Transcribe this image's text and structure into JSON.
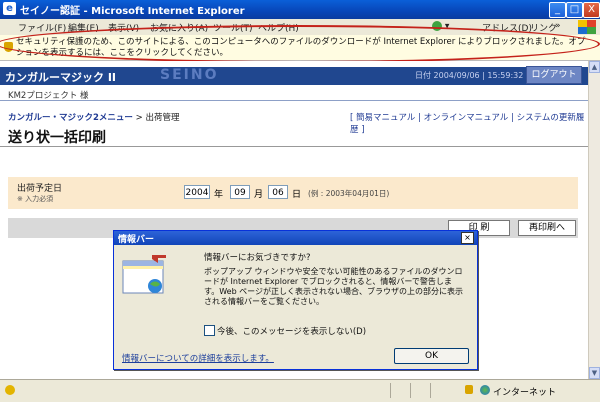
{
  "window": {
    "title": "セイノー認証 - Microsoft Internet Explorer",
    "buttons": [
      "_",
      "□",
      "X"
    ]
  },
  "menu": {
    "items": [
      "ファイル(F)",
      "編集(E)",
      "表示(V)",
      "お気に入り(A)",
      "ツール(T)",
      "ヘルプ(H)"
    ],
    "address_label": "アドレス(D)",
    "links_label": "リンク",
    "links_arrow": "»"
  },
  "infobar": {
    "text": "セキュリティ保護のため、このサイトによる、このコンピュータへのファイルのダウンロードが Internet Explorer によりブロックされました。オプションを表示するには、ここをクリックしてください。"
  },
  "header": {
    "brand": "カンガルーマジック II",
    "watermark": "SEINO",
    "datetime": "日付 2004/09/06 | 15:59:32",
    "logout": "ログアウト"
  },
  "project": "KM2プロジェクト 様",
  "breadcrumb": {
    "menu": "カンガルー・マジック2メニュー",
    "sep": ">",
    "current": "出荷管理"
  },
  "top_links": [
    "簡易マニュアル",
    "オンラインマニュアル",
    "システムの更新履歴"
  ],
  "page_title": "送り状一括印刷",
  "form": {
    "label": "出荷予定日",
    "required": "※ 入力必須",
    "year": "2004",
    "year_unit": "年",
    "month": "09",
    "month_unit": "月",
    "day": "06",
    "day_unit": "日",
    "example": "(例 : 2003年04月01日)"
  },
  "buttons": {
    "print": "印 刷",
    "reprint": "再印刷へ"
  },
  "dialog": {
    "title": "情報バー",
    "close": "×",
    "question": "情報バーにお気づきですか?",
    "body": "ポップアップ ウィンドウや安全でない可能性のあるファイルのダウンロードが Internet Explorer でブロックされると、情報バーで警告します。Web ページが正しく表示されない場合、ブラウザの上の部分に表示される情報バーをご覧ください。",
    "checkbox_label": "今後、このメッセージを表示しない(D)",
    "more_link": "情報バーについての詳細を表示します。",
    "ok": "OK"
  },
  "status": {
    "zone": "インターネット"
  }
}
